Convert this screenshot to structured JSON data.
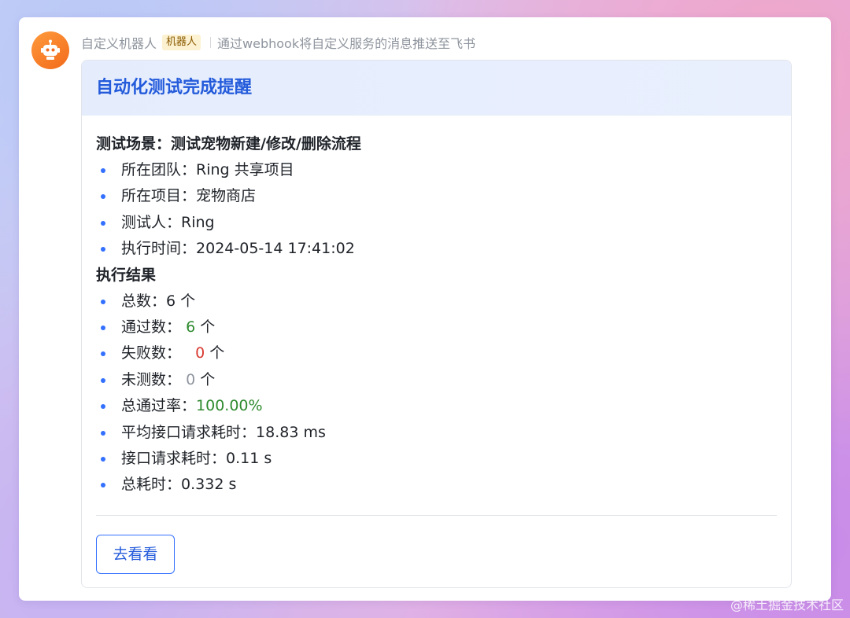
{
  "bot": {
    "name": "自定义机器人",
    "tag": "机器人",
    "description": "通过webhook将自定义服务的消息推送至飞书",
    "avatar_icon": "robot-icon"
  },
  "card": {
    "title": "自动化测试完成提醒",
    "scenario_title": "测试场景：测试宠物新建/修改/删除流程",
    "info_items": [
      {
        "label": "所在团队：",
        "value": "Ring 共享项目"
      },
      {
        "label": "所在项目：",
        "value": "宠物商店"
      },
      {
        "label": "测试人：",
        "value": "Ring"
      },
      {
        "label": "执行时间：",
        "value": "2024-05-14 17:41:02"
      }
    ],
    "results_title": "执行结果",
    "results": {
      "total": {
        "label": "总数：",
        "value": "6",
        "unit": " 个"
      },
      "passed": {
        "label": "通过数：",
        "value": "6",
        "unit": " 个"
      },
      "failed": {
        "label": "失败数：",
        "value": "0",
        "unit": " 个"
      },
      "untested": {
        "label": "未测数：",
        "value": "0",
        "unit": " 个"
      },
      "pass_rate": {
        "label": "总通过率：",
        "value": "100.00%"
      },
      "avg_request_time": {
        "label": "平均接口请求耗时：",
        "value": "18.83 ms"
      },
      "request_time": {
        "label": "接口请求耗时：",
        "value": "0.11 s"
      },
      "total_time": {
        "label": "总耗时：",
        "value": "0.332 s"
      }
    },
    "button_label": "去看看"
  },
  "watermark": "@稀土掘金技术社区",
  "colors": {
    "accent": "#3370ff",
    "title_blue": "#245bdb",
    "pass_green": "#2e8a2e",
    "fail_red": "#d83931",
    "neutral_grey": "#8f959e"
  }
}
